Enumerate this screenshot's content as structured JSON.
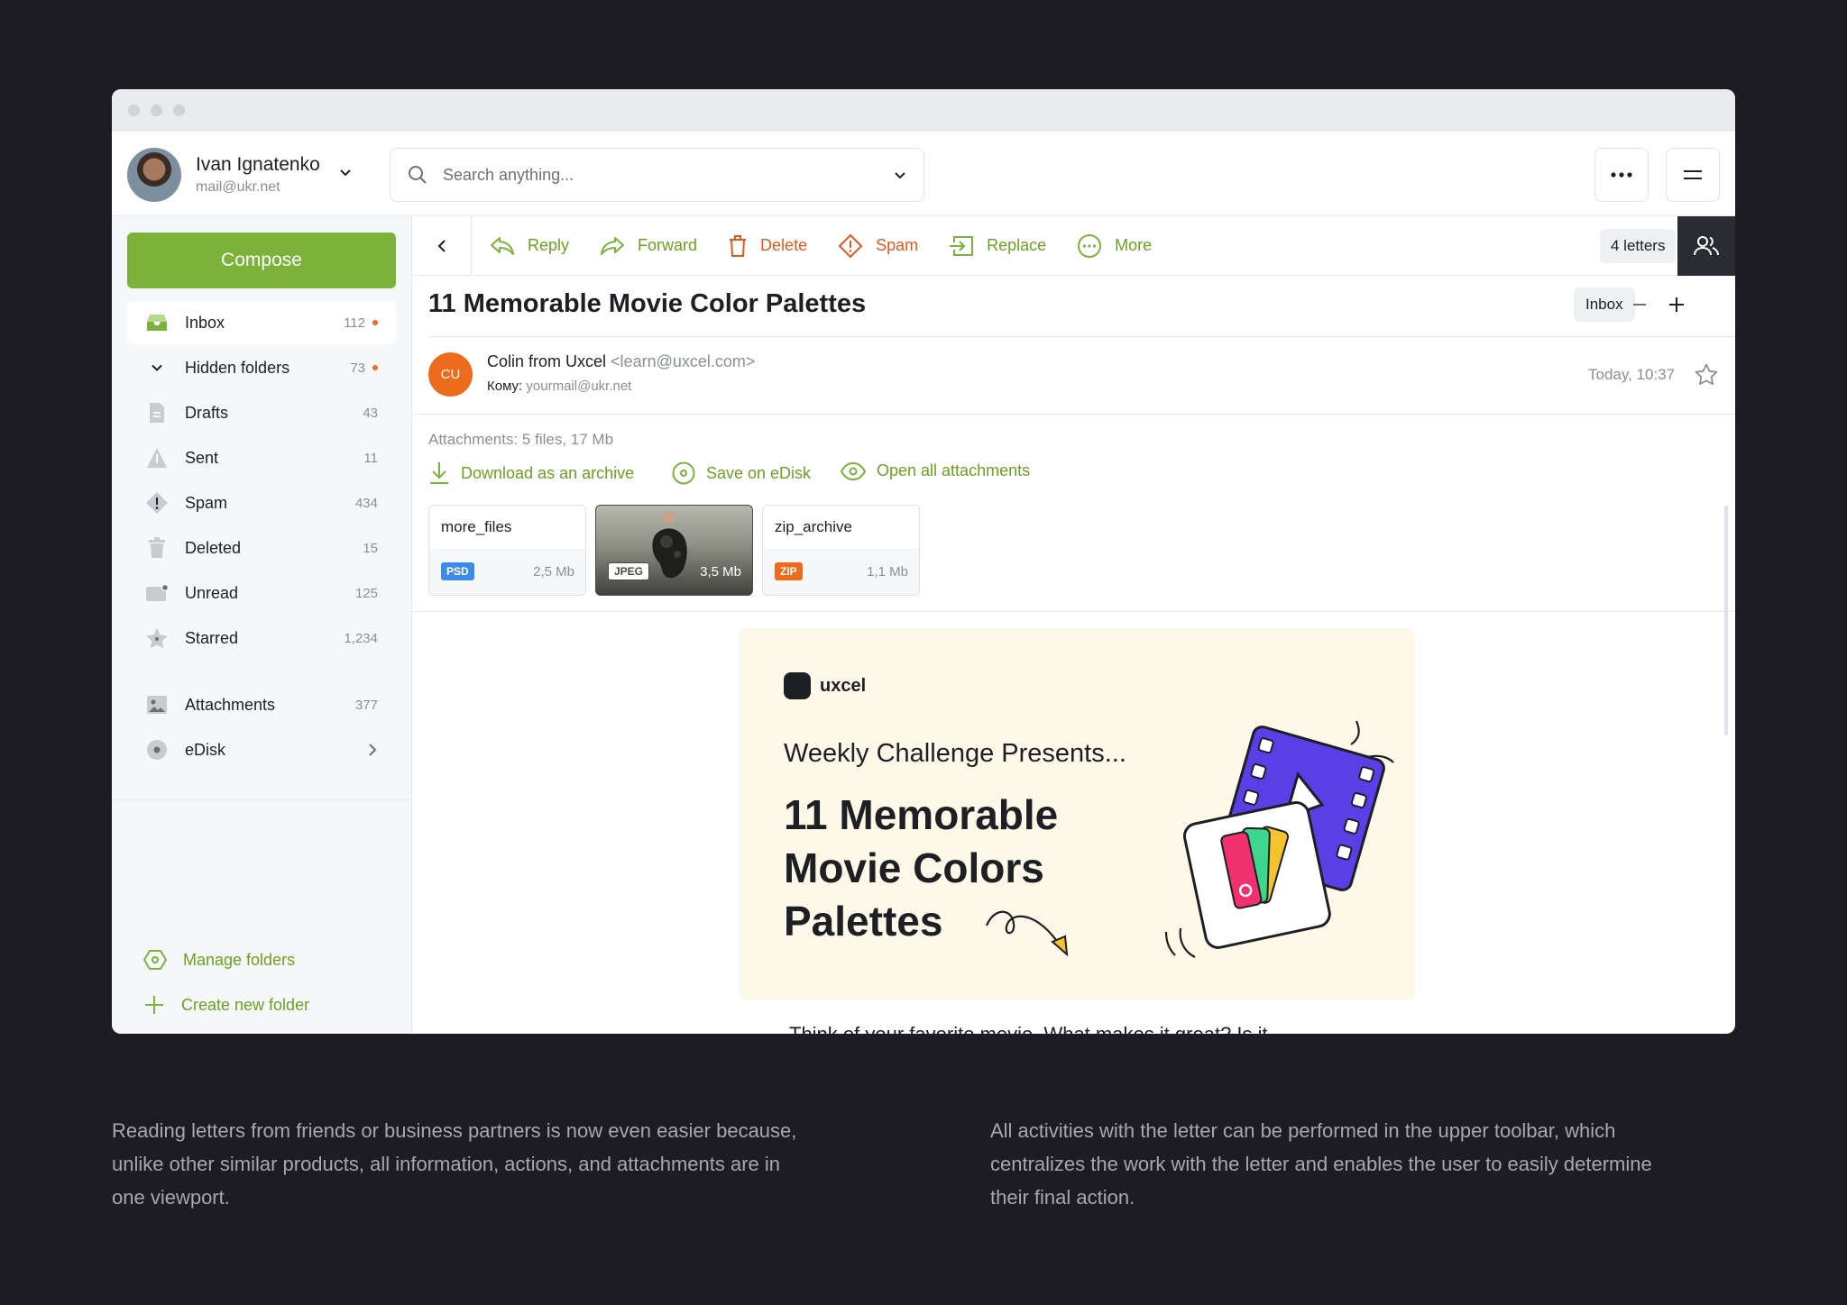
{
  "user": {
    "name": "Ivan Ignatenko",
    "email": "mail@ukr.net"
  },
  "search": {
    "placeholder": "Search anything..."
  },
  "sidebar": {
    "compose_label": "Compose",
    "folders": [
      {
        "label": "Inbox",
        "count": "112"
      },
      {
        "label": "Hidden folders",
        "count": "73"
      },
      {
        "label": "Drafts",
        "count": "43"
      },
      {
        "label": "Sent",
        "count": "11"
      },
      {
        "label": "Spam",
        "count": "434"
      },
      {
        "label": "Deleted",
        "count": "15"
      },
      {
        "label": "Unread",
        "count": "125"
      },
      {
        "label": "Starred",
        "count": "1,234"
      },
      {
        "label": "Attachments",
        "count": "377"
      },
      {
        "label": "eDisk",
        "count": ""
      }
    ],
    "manage_folders": "Manage folders",
    "create_folder": "Create new folder"
  },
  "toolbar": {
    "actions": {
      "reply": "Reply",
      "forward": "Forward",
      "delete": "Delete",
      "spam": "Spam",
      "replace": "Replace",
      "more": "More"
    },
    "letters_count": "4 letters"
  },
  "email": {
    "subject": "11 Memorable Movie Color Palettes",
    "folder_tag": "Inbox",
    "sender_initials": "CU",
    "sender_name": "Colin from Uxcel",
    "sender_email": "<learn@uxcel.com>",
    "to_label": "Кому:",
    "to_address": "yourmail@ukr.net",
    "date": "Today, 10:37",
    "attachments_label": "Attachments: 5 files, 17 Mb",
    "attachment_actions": {
      "download": "Download as an archive",
      "save": "Save on eDisk",
      "open": "Open all attachments"
    },
    "attachments": [
      {
        "name": "more_files",
        "type": "PSD",
        "size": "2,5 Mb"
      },
      {
        "name": "",
        "type": "JPEG",
        "size": "3,5 Mb"
      },
      {
        "name": "zip_archive",
        "type": "ZIP",
        "size": "1,1 Mb"
      }
    ],
    "banner": {
      "brand": "uxcel",
      "tagline": "Weekly Challenge Presents...",
      "title": "11 Memorable Movie Colors Palettes"
    },
    "body_preview": "Think of your favorite movie. What makes it great? Is it"
  },
  "captions": {
    "left": "Reading letters from friends or business partners is now even easier because, unlike other similar products, all information, actions, and attachments are in one viewport.",
    "right": "All activities with the letter can be performed in the upper toolbar, which centralizes the work with the letter and enables the user to easily determine their final action."
  },
  "colors": {
    "accent_green": "#7bb33a",
    "accent_orange": "#ec6b1c",
    "background": "#1c1c22",
    "psd_badge": "#3d8be8",
    "zip_badge": "#ec6b1c"
  }
}
